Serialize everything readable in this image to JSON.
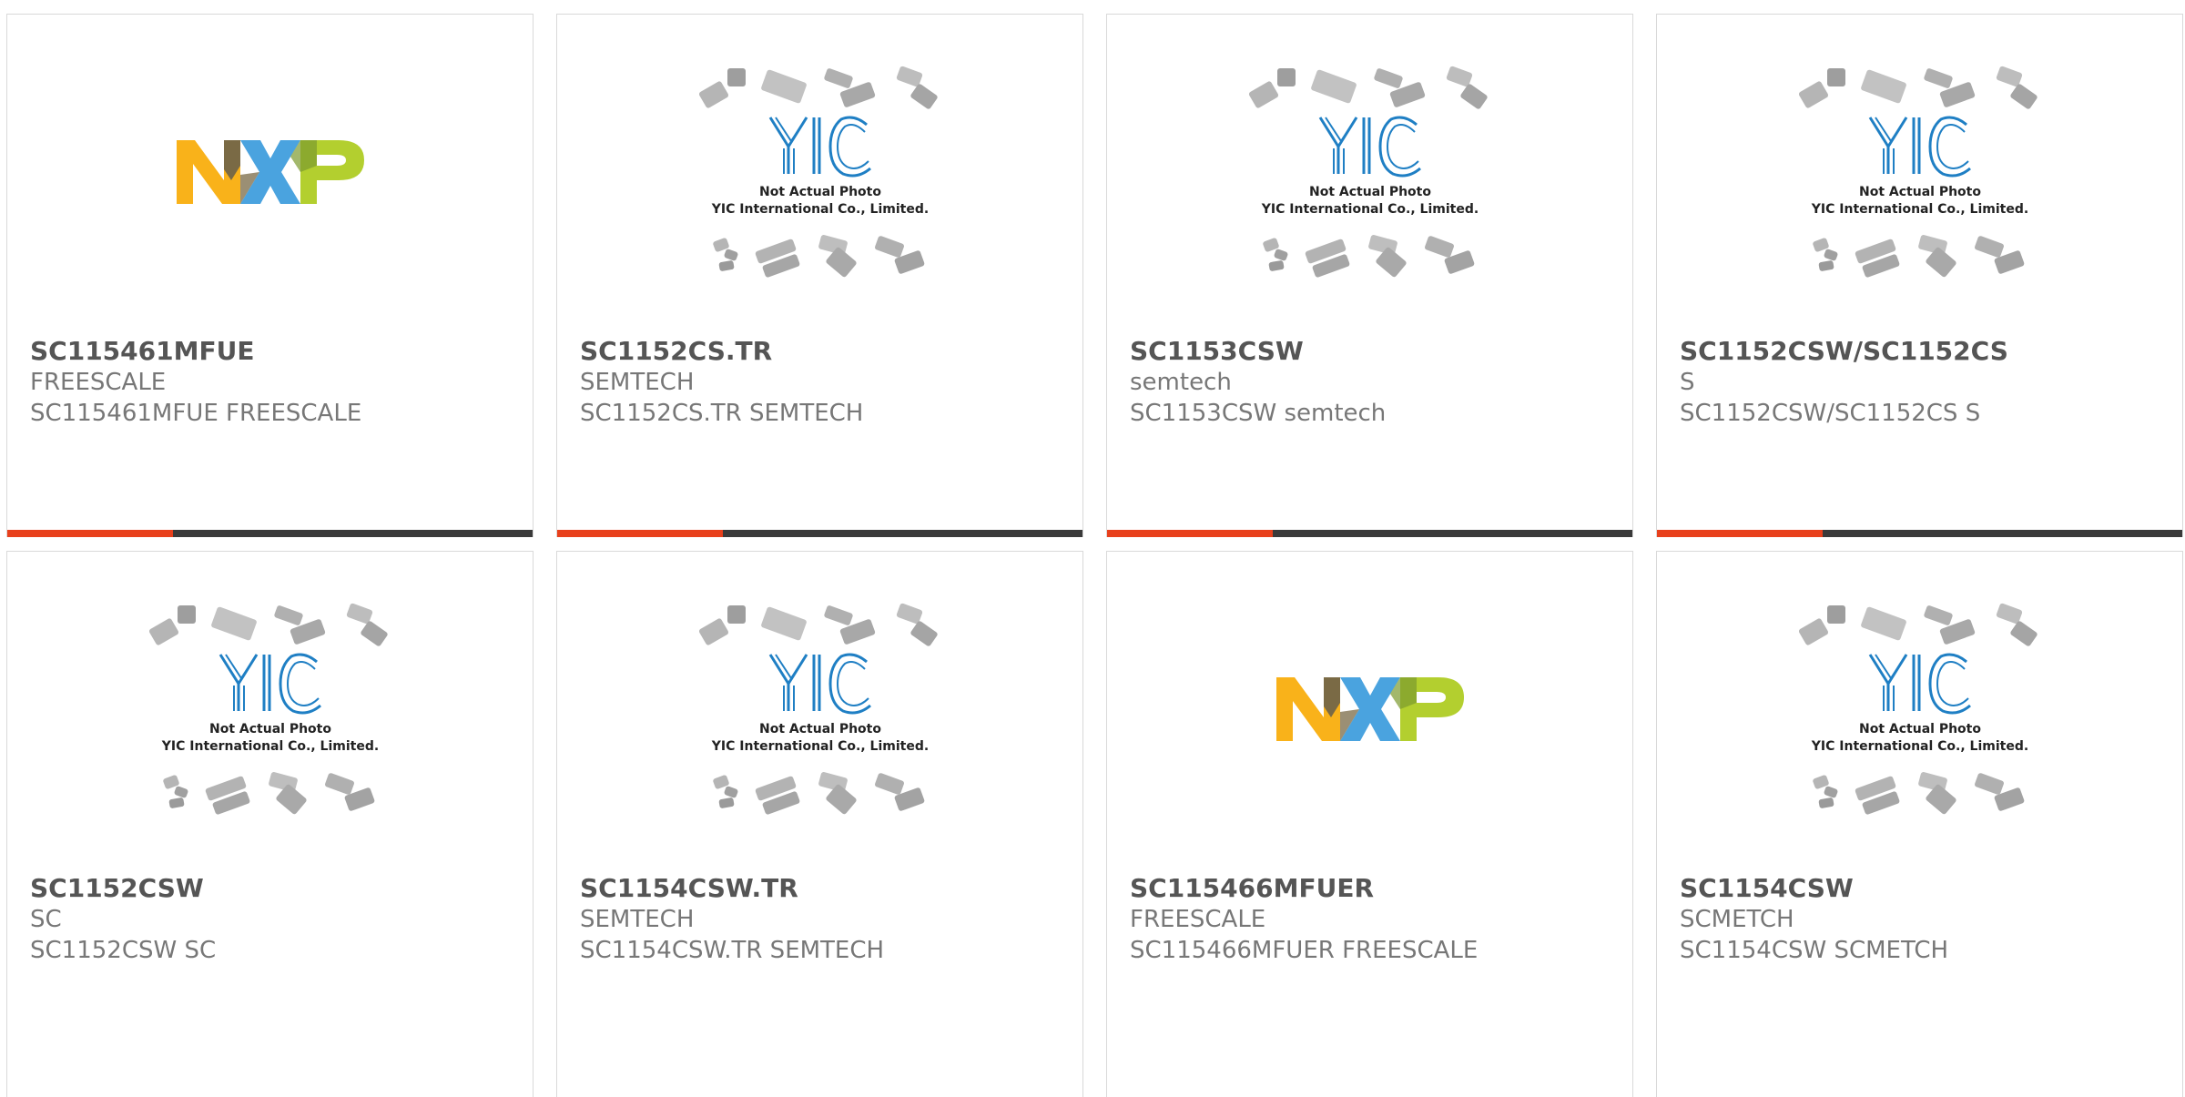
{
  "colors": {
    "accent": "#e8401c",
    "bar_dark": "#3a3a3a",
    "nxp_orange": "#f9b21a",
    "nxp_brown": "#7a6a45",
    "nxp_blue": "#4aa3df",
    "nxp_green": "#b3cf2f",
    "yic_blue": "#1f7fc4"
  },
  "placeholder": {
    "line1": "Not Actual Photo",
    "line2": "YIC International Co., Limited."
  },
  "nxp_logo_text": "NXP",
  "products": [
    {
      "part_number": "SC115461MFUE",
      "maker": "FREESCALE",
      "desc": "SC115461MFUE FREESCALE",
      "image": "nxp-logo"
    },
    {
      "part_number": "SC1152CS.TR",
      "maker": "SEMTECH",
      "desc": "SC1152CS.TR SEMTECH",
      "image": "yic-placeholder"
    },
    {
      "part_number": "SC1153CSW",
      "maker": "semtech",
      "desc": "SC1153CSW semtech",
      "image": "yic-placeholder"
    },
    {
      "part_number": "SC1152CSW/SC1152CS",
      "maker": "S",
      "desc": "SC1152CSW/SC1152CS S",
      "image": "yic-placeholder"
    },
    {
      "part_number": "SC1152CSW",
      "maker": "SC",
      "desc": "SC1152CSW SC",
      "image": "yic-placeholder"
    },
    {
      "part_number": "SC1154CSW.TR",
      "maker": "SEMTECH",
      "desc": "SC1154CSW.TR SEMTECH",
      "image": "yic-placeholder"
    },
    {
      "part_number": "SC115466MFUER",
      "maker": "FREESCALE",
      "desc": "SC115466MFUER FREESCALE",
      "image": "nxp-logo"
    },
    {
      "part_number": "SC1154CSW",
      "maker": "SCMETCH",
      "desc": "SC1154CSW SCMETCH",
      "image": "yic-placeholder"
    }
  ]
}
